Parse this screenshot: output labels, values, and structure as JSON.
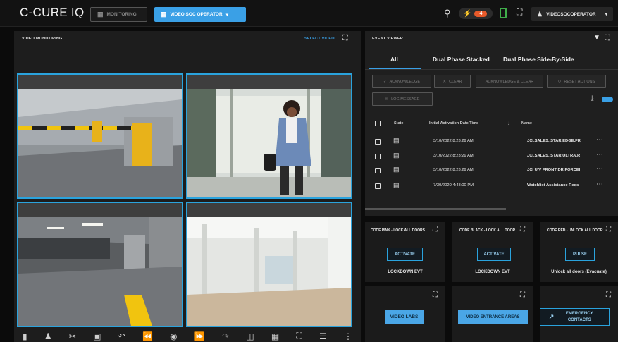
{
  "header": {
    "logo": "C-CURE IQ",
    "nav_monitoring": "MONITORING",
    "nav_operator": "VIDEO SOC OPERATOR",
    "alarm_count": "4",
    "user": "VIDEOSOCOPERATOR"
  },
  "video": {
    "title": "VIDEO MONITORING",
    "select_label": "SELECT VIDEO"
  },
  "events": {
    "title": "EVENT VIEWER",
    "tabs": [
      "All",
      "Dual Phase Stacked",
      "Dual Phase Side-By-Side"
    ],
    "buttons": {
      "acknowledge": "ACKNOWLEDGE",
      "clear": "CLEAR",
      "ack_clear": "ACKNOWLEDGE & CLEAR",
      "reset": "RESET ACTIONS",
      "log": "LOG MESSAGE"
    },
    "columns": {
      "state": "State",
      "date": "Initial Activation Date/Time",
      "name": "Name"
    },
    "rows": [
      {
        "date": "3/10/2022 8:23:29 AM",
        "name": "JCI.SALES.ISTAR.EDGE.FR"
      },
      {
        "date": "3/10/2022 8:23:29 AM",
        "name": "JCI.SALES.ISTAR.ULTRA.R"
      },
      {
        "date": "3/10/2022 8:23:29 AM",
        "name": "JCI U/V FRONT DR FORCEI"
      },
      {
        "date": "7/30/2020 4:48:00 PM",
        "name": "Watchlist Assistance Reqs"
      }
    ]
  },
  "actions": [
    {
      "title": "CODE PINK - LOCK ALL DOORS",
      "button": "ACTIVATE",
      "label": "LOCKDOWN EVT"
    },
    {
      "title": "CODE BLACK - LOCK ALL DOOR",
      "button": "ACTIVATE",
      "label": "LOCKDOWN EVT"
    },
    {
      "title": "CODE RED - UNLOCK ALL DOOR",
      "button": "PULSE",
      "label": "Unlock all doors (Evacuate)"
    }
  ],
  "links": {
    "video_labs": "VIDEO LABS",
    "video_entrance": "VIDEO ENTRANCE AREAS",
    "emergency": "EMERGENCY CONTACTS"
  },
  "colors": {
    "accent": "#3aa0e6",
    "tile_border": "#2aa3dd",
    "alarm": "#e85a2a"
  }
}
